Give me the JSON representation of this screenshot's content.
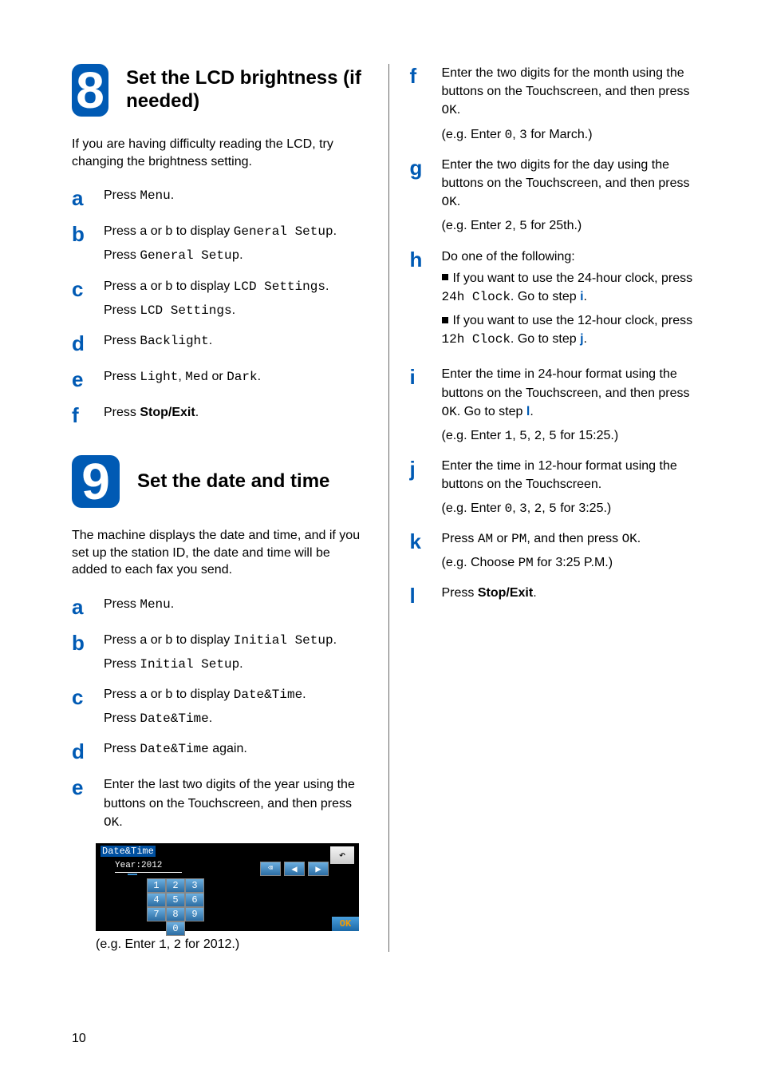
{
  "page": {
    "number": "10"
  },
  "section8": {
    "num": "8",
    "title": "Set the LCD brightness (if needed)",
    "intro": "If you are having difficulty reading the LCD, try changing the brightness setting.",
    "steps": {
      "a": {
        "l": "a",
        "pre": "Press ",
        "m1": "Menu",
        "post": "."
      },
      "b": {
        "l": "b",
        "line1_pre": "Press a or b to display ",
        "line1_m": "General Setup",
        "line1_post": ".",
        "line2_pre": "Press ",
        "line2_m": "General Setup",
        "line2_post": "."
      },
      "c": {
        "l": "c",
        "line1_pre": "Press a or b to display ",
        "line1_m": "LCD Settings",
        "line1_post": ".",
        "line2_pre": "Press ",
        "line2_m": "LCD Settings",
        "line2_post": "."
      },
      "d": {
        "l": "d",
        "pre": "Press ",
        "m1": "Backlight",
        "post": "."
      },
      "e": {
        "l": "e",
        "pre": "Press ",
        "m1": "Light",
        "mid1": ", ",
        "m2": "Med",
        "mid2": " or ",
        "m3": "Dark",
        "post": "."
      },
      "f": {
        "l": "f",
        "pre": "Press ",
        "b1": "Stop/Exit",
        "post": "."
      }
    }
  },
  "section9": {
    "num": "9",
    "title": "Set the date and time",
    "intro": "The machine displays the date and time, and if you set up the station ID, the date and time will be added to each fax you send.",
    "steps": {
      "a": {
        "l": "a",
        "pre": "Press ",
        "m1": "Menu",
        "post": "."
      },
      "b": {
        "l": "b",
        "line1_pre": "Press a or b to display ",
        "line1_m": "Initial Setup",
        "line1_post": ".",
        "line2_pre": "Press ",
        "line2_m": "Initial Setup",
        "line2_post": "."
      },
      "c": {
        "l": "c",
        "line1_pre": "Press a or b to display ",
        "line1_m": "Date&Time",
        "line1_post": ".",
        "line2_pre": "Press ",
        "line2_m": "Date&Time",
        "line2_post": "."
      },
      "d": {
        "l": "d",
        "pre": "Press ",
        "m1": "Date&Time",
        "post": " again."
      },
      "e": {
        "l": "e",
        "line1": "Enter the last two digits of the year using the buttons on the Touchscreen, and then press ",
        "m1": "OK",
        "post1": ".",
        "eg_pre": "(e.g. Enter ",
        "eg_m1": "1",
        "eg_mid": ", ",
        "eg_m2": "2",
        "eg_post": " for 2012.)"
      }
    },
    "lcd": {
      "title": "Date&Time",
      "year": "Year:2012",
      "ok": "OK"
    }
  },
  "right": {
    "f": {
      "l": "f",
      "line1": "Enter the two digits for the month using the buttons on the Touchscreen, and then press ",
      "m1": "OK",
      "post1": ".",
      "eg_pre": "(e.g. Enter ",
      "eg_m1": "0",
      "eg_mid": ", ",
      "eg_m2": "3",
      "eg_post": " for March.)"
    },
    "g": {
      "l": "g",
      "line1": "Enter the two digits for the day using the buttons on the Touchscreen, and then press ",
      "m1": "OK",
      "post1": ".",
      "eg_pre": "(e.g. Enter ",
      "eg_m1": "2",
      "eg_mid": ", ",
      "eg_m2": "5",
      "eg_post": " for 25th.)"
    },
    "h": {
      "l": "h",
      "lead": "Do one of the following:",
      "opt1_pre": "If you want to use the 24-hour clock, press ",
      "opt1_m": "24h Clock",
      "opt1_mid": ". Go to step ",
      "opt1_ref": "i",
      "opt1_post": ".",
      "opt2_pre": "If you want to use the 12-hour clock, press ",
      "opt2_m": "12h Clock",
      "opt2_mid": ". Go to step ",
      "opt2_ref": "j",
      "opt2_post": "."
    },
    "i": {
      "l": "i",
      "line1": "Enter the time in 24-hour format using the buttons on the Touchscreen, and then press ",
      "m1": "OK",
      "mid": ". Go to step ",
      "ref": "l",
      "post": ".",
      "eg_pre": "(e.g. Enter ",
      "eg_m1": "1",
      "eg_c1": ", ",
      "eg_m2": "5",
      "eg_c2": ", ",
      "eg_m3": "2",
      "eg_c3": ", ",
      "eg_m4": "5",
      "eg_post": " for 15:25.)"
    },
    "j": {
      "l": "j",
      "line1": "Enter the time in 12-hour format using the buttons on the Touchscreen.",
      "eg_pre": "(e.g. Enter ",
      "eg_m1": "0",
      "eg_c1": ", ",
      "eg_m2": "3",
      "eg_c2": ", ",
      "eg_m3": "2",
      "eg_c3": ", ",
      "eg_m4": "5",
      "eg_post": " for 3:25.)"
    },
    "k": {
      "l": "k",
      "pre": "Press ",
      "m1": "AM",
      "mid1": " or ",
      "m2": "PM",
      "mid2": ", and then press ",
      "m3": "OK",
      "post": ".",
      "eg_pre": "(e.g. Choose ",
      "eg_m1": "PM",
      "eg_post": " for 3:25 P.M.)"
    },
    "l": {
      "l": "l",
      "pre": "Press ",
      "b1": "Stop/Exit",
      "post": "."
    }
  }
}
